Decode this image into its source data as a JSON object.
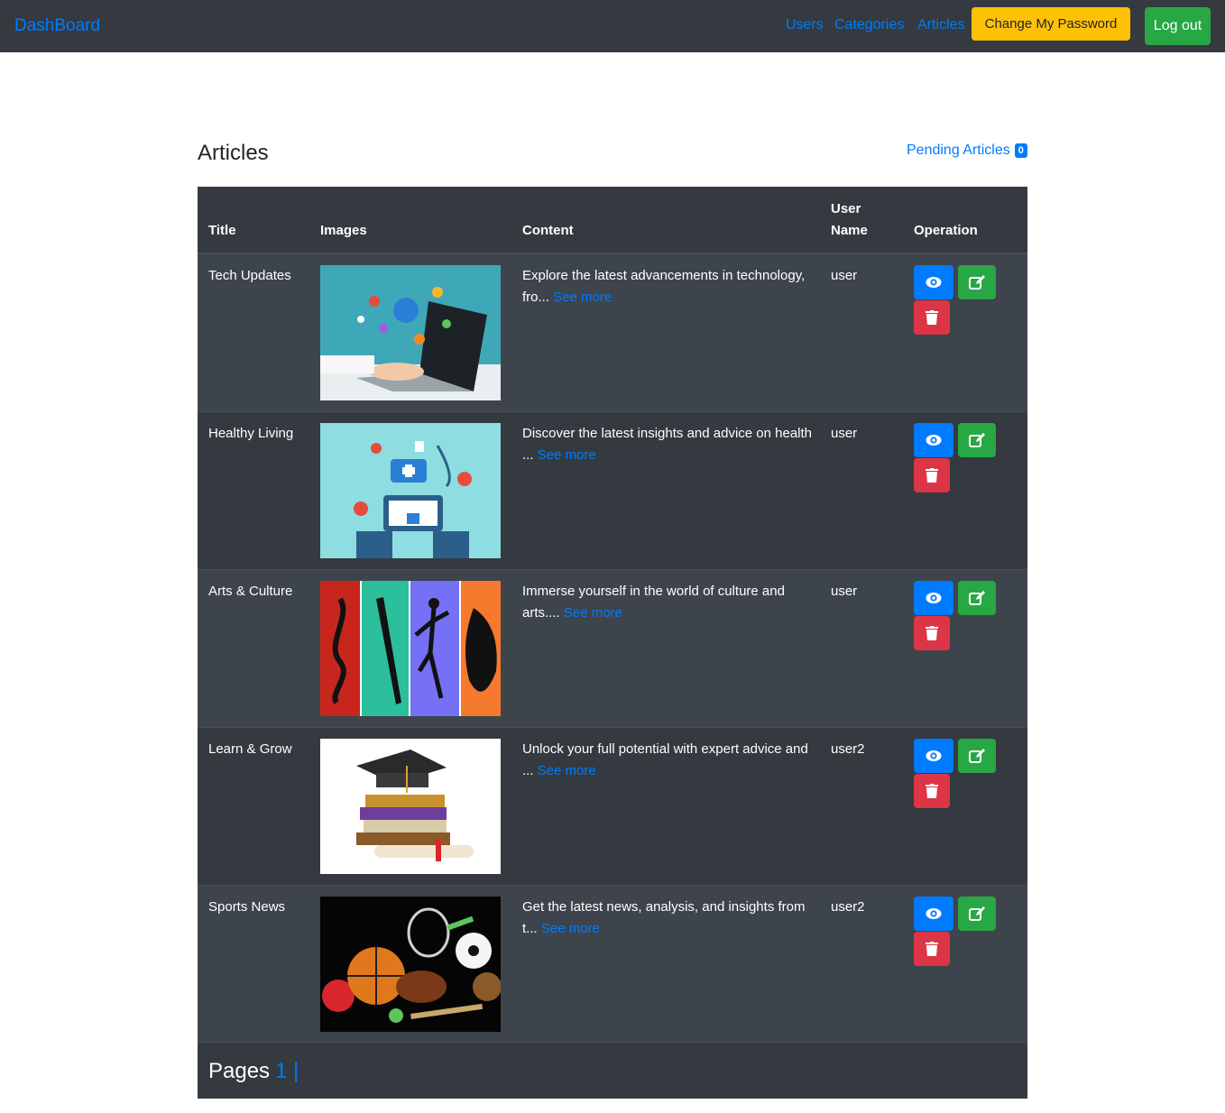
{
  "nav": {
    "brand": "DashBoard",
    "links": [
      "Users",
      "Categories",
      "Articles"
    ],
    "change_password": "Change My Password",
    "logout": "Log out"
  },
  "page": {
    "title": "Articles",
    "pending_label": "Pending Articles",
    "pending_count": "0"
  },
  "table": {
    "headers": [
      "Title",
      "Images",
      "Content",
      "User Name",
      "Operation"
    ],
    "header_user_line1": "User",
    "header_user_line2": "Name",
    "see_more": "See more",
    "rows": [
      {
        "title": "Tech Updates",
        "image": "laptop-technology-image",
        "content": "Explore the latest advancements in technology, fro...",
        "user": "user"
      },
      {
        "title": "Healthy Living",
        "image": "health-care-image",
        "content": "Discover the latest insights and advice on health ...",
        "user": "user"
      },
      {
        "title": "Arts & Culture",
        "image": "arts-culture-image",
        "content": "Immerse yourself in the world of culture and arts....",
        "user": "user"
      },
      {
        "title": "Learn & Grow",
        "image": "graduation-books-image",
        "content": "Unlock your full potential with expert advice and ...",
        "user": "user2"
      },
      {
        "title": "Sports News",
        "image": "sports-balls-image",
        "content": "Get the latest news, analysis, and insights from t...",
        "user": "user2"
      }
    ]
  },
  "pager": {
    "label": "Pages",
    "current": "1 |"
  },
  "icons": {
    "view": "eye-icon",
    "edit": "edit-icon",
    "delete": "trash-icon"
  },
  "colors": {
    "primary": "#007bff",
    "success": "#28a745",
    "warning": "#ffc107",
    "danger": "#dc3545",
    "dark": "#343a40"
  }
}
